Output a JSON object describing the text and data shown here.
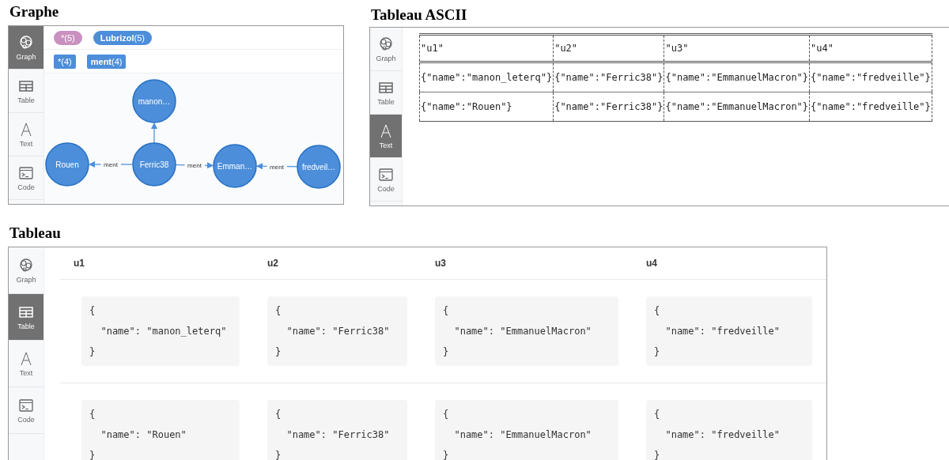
{
  "graph_section": {
    "heading": "Graphe",
    "sidebar": [
      {
        "kind": "graph",
        "label": "Graph",
        "selected": true
      },
      {
        "kind": "table",
        "label": "Table",
        "selected": false
      },
      {
        "kind": "text",
        "label": "Text",
        "selected": false
      },
      {
        "kind": "code",
        "label": "Code",
        "selected": false
      }
    ],
    "node_labels": [
      {
        "text": "*(5)",
        "color": "#c990c0"
      },
      {
        "text": "**Lubrizol**(5)",
        "color": "#4c8eda"
      }
    ],
    "relationship_types": [
      {
        "text": "*(4)"
      },
      {
        "text": "**ment**(4)"
      }
    ],
    "nodes": [
      {
        "label": "manon…"
      },
      {
        "label": "Rouen"
      },
      {
        "label": "Ferric38"
      },
      {
        "label": "Emman…"
      },
      {
        "label": "fredveil…"
      }
    ],
    "edges": [
      {
        "kind": "plain"
      },
      {
        "kind": "labeled",
        "label": "ment"
      },
      {
        "kind": "labeled",
        "label": "ment"
      },
      {
        "kind": "labeled",
        "label": "ment"
      }
    ]
  },
  "ascii_section": {
    "heading": "Tableau ASCII",
    "sidebar": [
      {
        "kind": "graph",
        "label": "Graph",
        "selected": false
      },
      {
        "kind": "table",
        "label": "Table",
        "selected": false
      },
      {
        "kind": "text",
        "label": "Text",
        "selected": true
      },
      {
        "kind": "code",
        "label": "Code",
        "selected": false
      }
    ],
    "columns": [
      "\"u1\"",
      "\"u2\"",
      "\"u3\"",
      "\"u4\""
    ],
    "rows": [
      [
        "{\"name\":\"manon_leterq\"}",
        "{\"name\":\"Ferric38\"}",
        "{\"name\":\"EmmanuelMacron\"}",
        "{\"name\":\"fredveille\"}"
      ],
      [
        "{\"name\":\"Rouen\"}",
        "{\"name\":\"Ferric38\"}",
        "{\"name\":\"EmmanuelMacron\"}",
        "{\"name\":\"fredveille\"}"
      ]
    ]
  },
  "table_section": {
    "heading": "Tableau",
    "sidebar": [
      {
        "kind": "graph",
        "label": "Graph",
        "selected": false
      },
      {
        "kind": "table",
        "label": "Table",
        "selected": true
      },
      {
        "kind": "text",
        "label": "Text",
        "selected": false
      },
      {
        "kind": "code",
        "label": "Code",
        "selected": false
      }
    ],
    "columns": [
      "u1",
      "u2",
      "u3",
      "u4"
    ],
    "rows": [
      [
        "{\n  \"name\": \"manon_leterq\"\n}",
        "{\n  \"name\": \"Ferric38\"\n}",
        "{\n  \"name\": \"EmmanuelMacron\"\n}",
        "{\n  \"name\": \"fredveille\"\n}"
      ],
      [
        "{\n  \"name\": \"Rouen\"\n}",
        "{\n  \"name\": \"Ferric38\"\n}",
        "{\n  \"name\": \"EmmanuelMacron\"\n}",
        "{\n  \"name\": \"fredveille\"\n}"
      ]
    ]
  }
}
